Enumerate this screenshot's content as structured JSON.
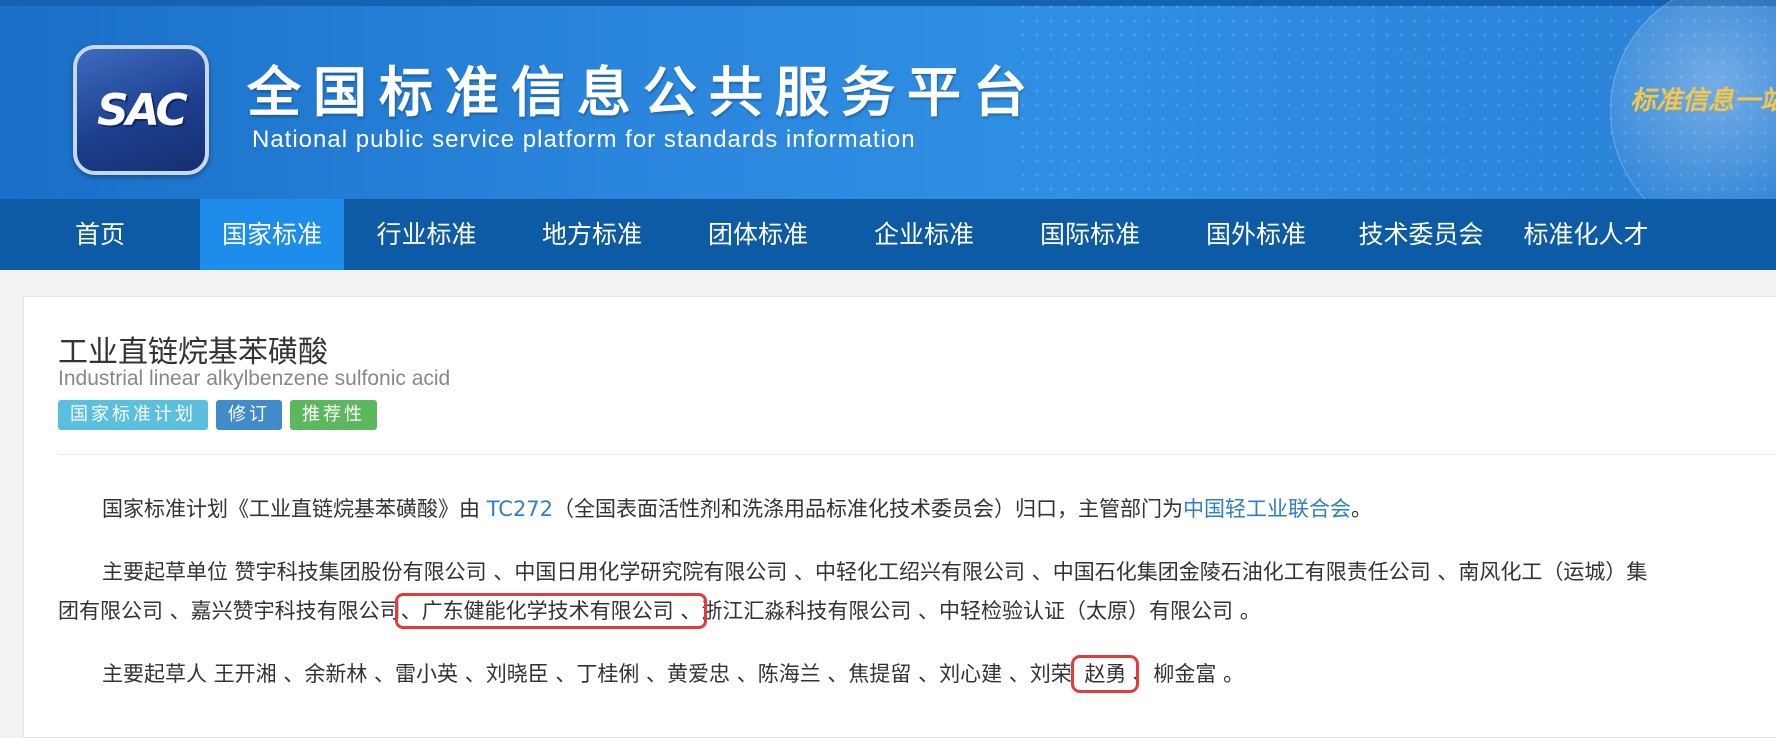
{
  "header": {
    "logo_text": "SAC",
    "title": "全国标准信息公共服务平台",
    "subtitle": "National public service platform  for standards information",
    "slogan": "标准信息一站"
  },
  "nav": {
    "items": [
      {
        "label": "首页"
      },
      {
        "label": "国家标准"
      },
      {
        "label": "行业标准"
      },
      {
        "label": "地方标准"
      },
      {
        "label": "团体标准"
      },
      {
        "label": "企业标准"
      },
      {
        "label": "国际标准"
      },
      {
        "label": "国外标准"
      },
      {
        "label": "技术委员会"
      },
      {
        "label": "标准化人才"
      }
    ],
    "active_index": 1
  },
  "standard": {
    "title_zh": "工业直链烷基苯磺酸",
    "title_en": "Industrial linear alkylbenzene sulfonic acid",
    "tags": [
      "国家标准计划",
      "修订",
      "推荐性"
    ]
  },
  "intro": {
    "prefix": "国家标准计划《工业直链烷基苯磺酸》由 ",
    "tc_link": "TC272",
    "middle": "（全国表面活性剂和洗涤用品标准化技术委员会）归口，主管部门为",
    "dept_link": "中国轻工业联合会",
    "suffix": "。"
  },
  "drafting_units": {
    "line1": "主要起草单位 赞宇科技集团股份有限公司 、中国日用化学研究院有限公司 、中轻化工绍兴有限公司 、中国石化集团金陵石油化工有限责任公司 、南风化工（运城）集",
    "line2_before": "团有限公司 、嘉兴赞宇科技有限公司",
    "line2_highlight": "、广东健能化学技术有限公司 、",
    "line2_after": "浙江汇淼科技有限公司 、中轻检验认证（太原）有限公司 。"
  },
  "drafters": {
    "before": "主要起草人 王开湘 、余新林 、雷小英 、刘晓臣 、丁桂俐 、黄爱忠 、陈海兰 、焦提留 、刘心建 、刘荣 ",
    "highlight": "赵勇",
    "after": "、柳金富 。"
  },
  "colors": {
    "nav_bg": "#0d5aa5",
    "nav_active": "#1e8cea",
    "link": "#2f7fc8",
    "highlight_box": "#e53b3b"
  }
}
